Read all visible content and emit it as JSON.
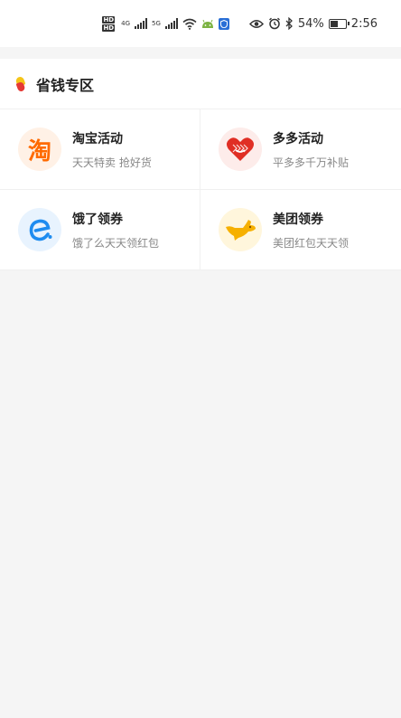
{
  "status_bar": {
    "hd_top": "HD",
    "hd_bottom": "HD",
    "net1": "4G",
    "net2": "5G",
    "battery_text": "54%",
    "battery_level": 0.54,
    "time": "2:56"
  },
  "section": {
    "title": "省钱专区"
  },
  "items": [
    {
      "title": "淘宝活动",
      "subtitle": "天天特卖 抢好货",
      "icon": "taobao-icon",
      "logo_char": "淘",
      "color": "#ff6a00"
    },
    {
      "title": "多多活动",
      "subtitle": "平多多千万补贴",
      "icon": "pinduoduo-icon",
      "color": "#e02e24"
    },
    {
      "title": "饿了领券",
      "subtitle": "饿了么天天领红包",
      "icon": "eleme-icon",
      "logo_char": "e",
      "color": "#1e8cf0"
    },
    {
      "title": "美团领券",
      "subtitle": "美团红包天天领",
      "icon": "meituan-icon",
      "color": "#f6b000"
    }
  ]
}
